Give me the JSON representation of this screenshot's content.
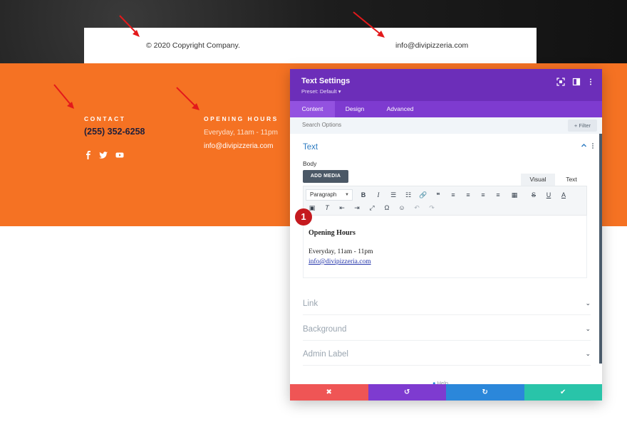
{
  "footer_bar": {
    "copyright": "© 2020 Copyright Company.",
    "email": "info@divipizzeria.com"
  },
  "contact": {
    "heading": "CONTACT",
    "phone": "(255) 352-6258",
    "social_icons": [
      "facebook-icon",
      "twitter-icon",
      "youtube-icon"
    ]
  },
  "hours": {
    "heading": "OPENING HOURS",
    "text": "Everyday, 11am - 11pm",
    "email": "info@divipizzeria.com"
  },
  "modal": {
    "title": "Text Settings",
    "preset": "Preset: Default ▾",
    "tabs": [
      "Content",
      "Design",
      "Advanced"
    ],
    "active_tab": "Content",
    "search_placeholder": "Search Options",
    "filter_label": "+ Filter",
    "section_title": "Text",
    "body_label": "Body",
    "add_media": "ADD MEDIA",
    "mode_visual": "Visual",
    "mode_text": "Text",
    "paragraph_select": "Paragraph",
    "editor": {
      "heading": "Opening Hours",
      "line": "Everyday, 11am - 11pm",
      "link": "info@divipizzeria.com"
    },
    "badge": "1",
    "collapsed_sections": [
      "Link",
      "Background",
      "Admin Label"
    ],
    "help": "Help",
    "footer_buttons": [
      {
        "name": "cancel",
        "glyph": "✖",
        "color": "#ef5555"
      },
      {
        "name": "undo",
        "glyph": "↺",
        "color": "#7e3bd0"
      },
      {
        "name": "redo",
        "glyph": "↻",
        "color": "#2b87da"
      },
      {
        "name": "save",
        "glyph": "✔",
        "color": "#29c4a9"
      }
    ]
  },
  "colors": {
    "orange": "#f57223",
    "purple_header": "#6c2eb9",
    "purple_tabs": "#7e3bd0",
    "arrow_red": "#e3191b"
  }
}
